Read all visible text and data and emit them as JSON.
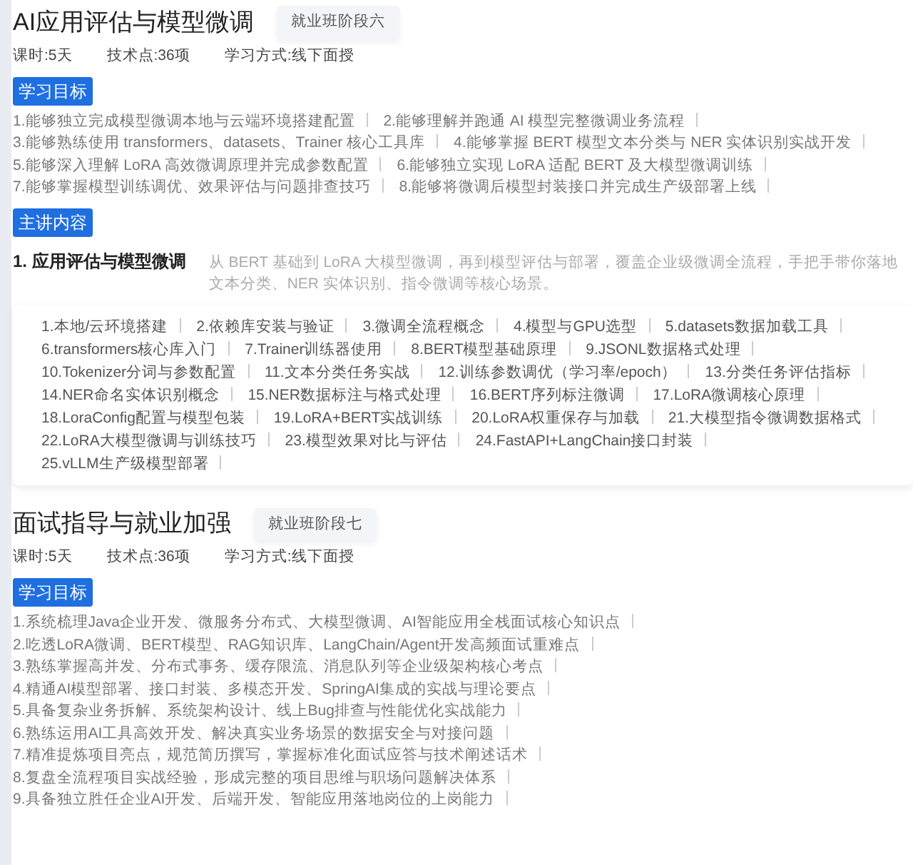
{
  "stages": [
    {
      "title": "AI应用评估与模型微调",
      "tag": "就业班阶段六",
      "meta": [
        "课时:5天",
        "技术点:36项",
        "学习方式:线下面授"
      ],
      "sections": [
        {
          "kind": "goals",
          "label": "学习目标",
          "items": [
            "1.能够独立完成模型微调本地与云端环境搭建配置",
            "2.能够理解并跑通 AI 模型完整微调业务流程",
            "3.能够熟练使用 transformers、datasets、Trainer 核心工具库",
            "4.能够掌握 BERT 模型文本分类与 NER 实体识别实战开发",
            "5.能够深入理解 LoRA 高效微调原理并完成参数配置",
            "6.能够独立实现 LoRA 适配 BERT 及大模型微调训练",
            "7.能够掌握模型训练调优、效果评估与问题排查技巧",
            "8.能够将微调后模型封装接口并完成生产级部署上线"
          ]
        },
        {
          "kind": "content",
          "label": "主讲内容",
          "modules": [
            {
              "title": "1. 应用评估与模型微调",
              "desc": "从 BERT 基础到 LoRA 大模型微调，再到模型评估与部署，覆盖企业级微调全流程，手把手带你落地文本分类、NER 实体识别、指令微调等核心场景。",
              "topics": [
                "1.本地/云环境搭建",
                "2.依赖库安装与验证",
                "3.微调全流程概念",
                "4.模型与GPU选型",
                "5.datasets数据加载工具",
                "6.transformers核心库入门",
                "7.Trainer训练器使用",
                "8.BERT模型基础原理",
                "9.JSONL数据格式处理",
                "10.Tokenizer分词与参数配置",
                "11.文本分类任务实战",
                "12.训练参数调优（学习率/epoch）",
                "13.分类任务评估指标",
                "14.NER命名实体识别概念",
                "15.NER数据标注与格式处理",
                "16.BERT序列标注微调",
                "17.LoRA微调核心原理",
                "18.LoraConfig配置与模型包装",
                "19.LoRA+BERT实战训练",
                "20.LoRA权重保存与加载",
                "21.大模型指令微调数据格式",
                "22.LoRA大模型微调与训练技巧",
                "23.模型效果对比与评估",
                "24.FastAPI+LangChain接口封装",
                "25.vLLM生产级模型部署"
              ]
            }
          ]
        }
      ]
    },
    {
      "title": "面试指导与就业加强",
      "tag": "就业班阶段七",
      "meta": [
        "课时:5天",
        "技术点:36项",
        "学习方式:线下面授"
      ],
      "sections": [
        {
          "kind": "goals",
          "label": "学习目标",
          "items": [
            "1.系统梳理Java企业开发、微服务分布式、大模型微调、AI智能应用全栈面试核心知识点",
            "2.吃透LoRA微调、BERT模型、RAG知识库、LangChain/Agent开发高频面试重难点",
            "3.熟练掌握高并发、分布式事务、缓存限流、消息队列等企业级架构核心考点",
            "4.精通AI模型部署、接口封装、多模态开发、SpringAI集成的实战与理论要点",
            "5.具备复杂业务拆解、系统架构设计、线上Bug排查与性能优化实战能力",
            "6.熟练运用AI工具高效开发、解决真实业务场景的数据安全与对接问题",
            "7.精准提炼项目亮点，规范简历撰写，掌握标准化面试应答与技术阐述话术",
            "8.复盘全流程项目实战经验，形成完整的项目思维与职场问题解决体系",
            "9.具备独立胜任企业AI开发、后端开发、智能应用落地岗位的上岗能力"
          ]
        }
      ]
    }
  ]
}
